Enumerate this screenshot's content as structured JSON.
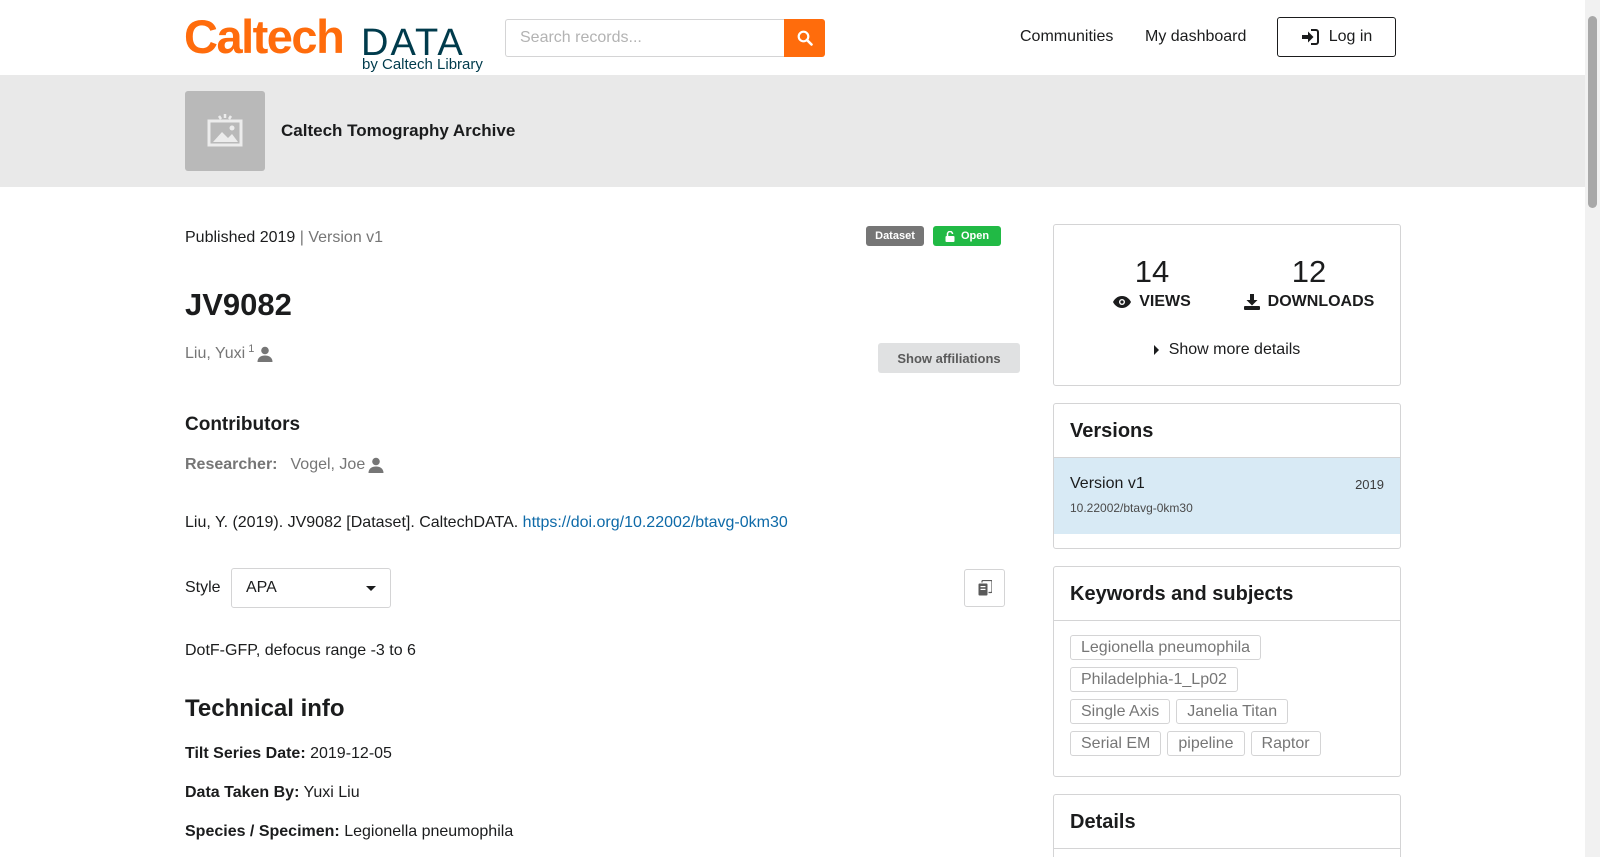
{
  "header": {
    "logo": {
      "caltech": "Caltech",
      "data": "DATA",
      "byline": "by Caltech Library"
    },
    "search": {
      "placeholder": "Search records..."
    },
    "nav": {
      "communities": "Communities",
      "dashboard": "My dashboard",
      "login": "Log in"
    },
    "colors": {
      "brand": "#ff6c0c",
      "logo_text": "#003b4c"
    }
  },
  "community": {
    "name": "Caltech Tomography Archive"
  },
  "record": {
    "published": "Published 2019",
    "separator": " | ",
    "version": "Version v1",
    "resource_type": "Dataset",
    "access": "Open",
    "title": "JV9082",
    "creator": {
      "name": "Liu, Yuxi",
      "affiliation_ref": "1"
    },
    "show_affiliations": "Show affiliations",
    "contributors_heading": "Contributors",
    "contributor": {
      "role": "Researcher:",
      "name": "Vogel, Joe"
    },
    "citation": {
      "text": "Liu, Y. (2019). JV9082 [Dataset]. CaltechDATA. ",
      "doi_link": "https://doi.org/10.22002/btavg-0km30"
    },
    "style_label": "Style",
    "style_value": "APA",
    "description": "DotF-GFP, defocus range -3 to 6",
    "technical_heading": "Technical info",
    "technical": [
      {
        "label": "Tilt Series Date:",
        "value": "2019-12-05"
      },
      {
        "label": "Data Taken By:",
        "value": "Yuxi Liu"
      },
      {
        "label": "Species / Specimen:",
        "value": "Legionella pneumophila"
      }
    ]
  },
  "sidebar": {
    "stats": {
      "views": {
        "count": "14",
        "label": "VIEWS"
      },
      "downloads": {
        "count": "12",
        "label": "DOWNLOADS"
      },
      "more": "Show more details"
    },
    "versions": {
      "heading": "Versions",
      "items": [
        {
          "label": "Version v1",
          "year": "2019",
          "doi": "10.22002/btavg-0km30"
        }
      ]
    },
    "keywords": {
      "heading": "Keywords and subjects",
      "items": [
        "Legionella pneumophila",
        "Philadelphia-1_Lp02",
        "Single Axis",
        "Janelia Titan",
        "Serial EM",
        "pipeline",
        "Raptor"
      ]
    },
    "details": {
      "heading": "Details"
    }
  }
}
